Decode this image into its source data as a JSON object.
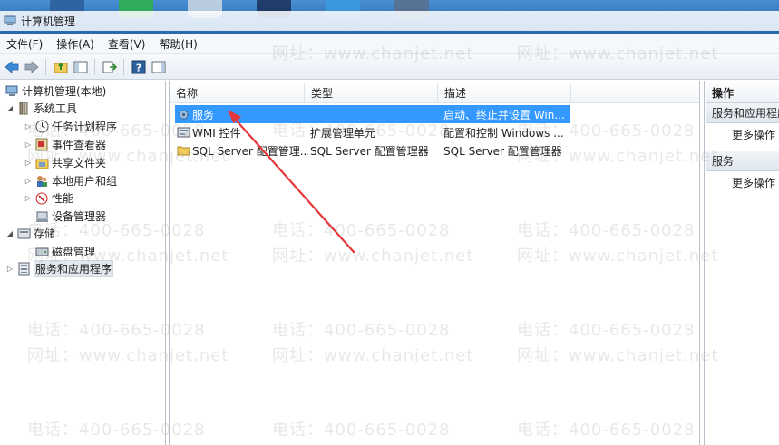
{
  "window": {
    "title": "计算机管理"
  },
  "menu": [
    "文件(F)",
    "操作(A)",
    "查看(V)",
    "帮助(H)"
  ],
  "tree": {
    "root": "计算机管理(本地)",
    "system_tools": "系统工具",
    "task_scheduler": "任务计划程序",
    "event_viewer": "事件查看器",
    "shared_folders": "共享文件夹",
    "local_users": "本地用户和组",
    "performance": "性能",
    "device_manager": "设备管理器",
    "storage": "存储",
    "disk_management": "磁盘管理",
    "services_apps": "服务和应用程序"
  },
  "list": {
    "columns": [
      "名称",
      "类型",
      "描述"
    ],
    "rows": [
      {
        "name": "服务",
        "type": "",
        "desc": "启动、终止并设置 Win..."
      },
      {
        "name": "WMI 控件",
        "type": "扩展管理单元",
        "desc": "配置和控制 Windows ..."
      },
      {
        "name": "SQL Server 配置管理...",
        "type": "SQL Server 配置管理器",
        "desc": "SQL Server 配置管理器"
      }
    ]
  },
  "actions": {
    "header": "操作",
    "section1": "服务和应用程序",
    "more1": "更多操作",
    "section2": "服务",
    "more2": "更多操作"
  },
  "watermark": {
    "phone": "电话：400-665-0028",
    "site": "网址：www.chanjet.net"
  },
  "colors": {
    "selection": "#3399ff",
    "arrow": "#e5363a"
  }
}
